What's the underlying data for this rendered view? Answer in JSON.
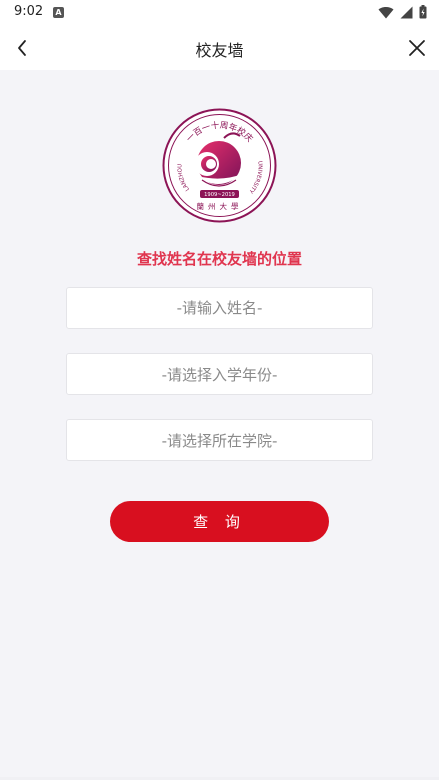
{
  "status_bar": {
    "time": "9:02",
    "notification_icon": "a-icon",
    "icons": [
      "wifi-icon",
      "signal-icon",
      "battery-icon"
    ]
  },
  "nav": {
    "title": "校友墙",
    "back_icon": "chevron-left-icon",
    "close_icon": "close-icon"
  },
  "logo": {
    "arc_top_text": "一百一十周年校庆",
    "left_text": "LANZHOU",
    "right_text": "UNIVERSITY",
    "years_text": "1909~2019",
    "bottom_text": "蘭州大學"
  },
  "headline": "查找姓名在校友墙的位置",
  "form": {
    "name_placeholder": "-请输入姓名-",
    "year_placeholder": "-请选择入学年份-",
    "college_placeholder": "-请选择所在学院-",
    "submit_label": "查 询"
  },
  "colors": {
    "accent": "#e0354f",
    "button": "#d80f1f",
    "logo_dark": "#8c1456",
    "logo_pink": "#d0246a",
    "background": "#f4f4f8"
  }
}
